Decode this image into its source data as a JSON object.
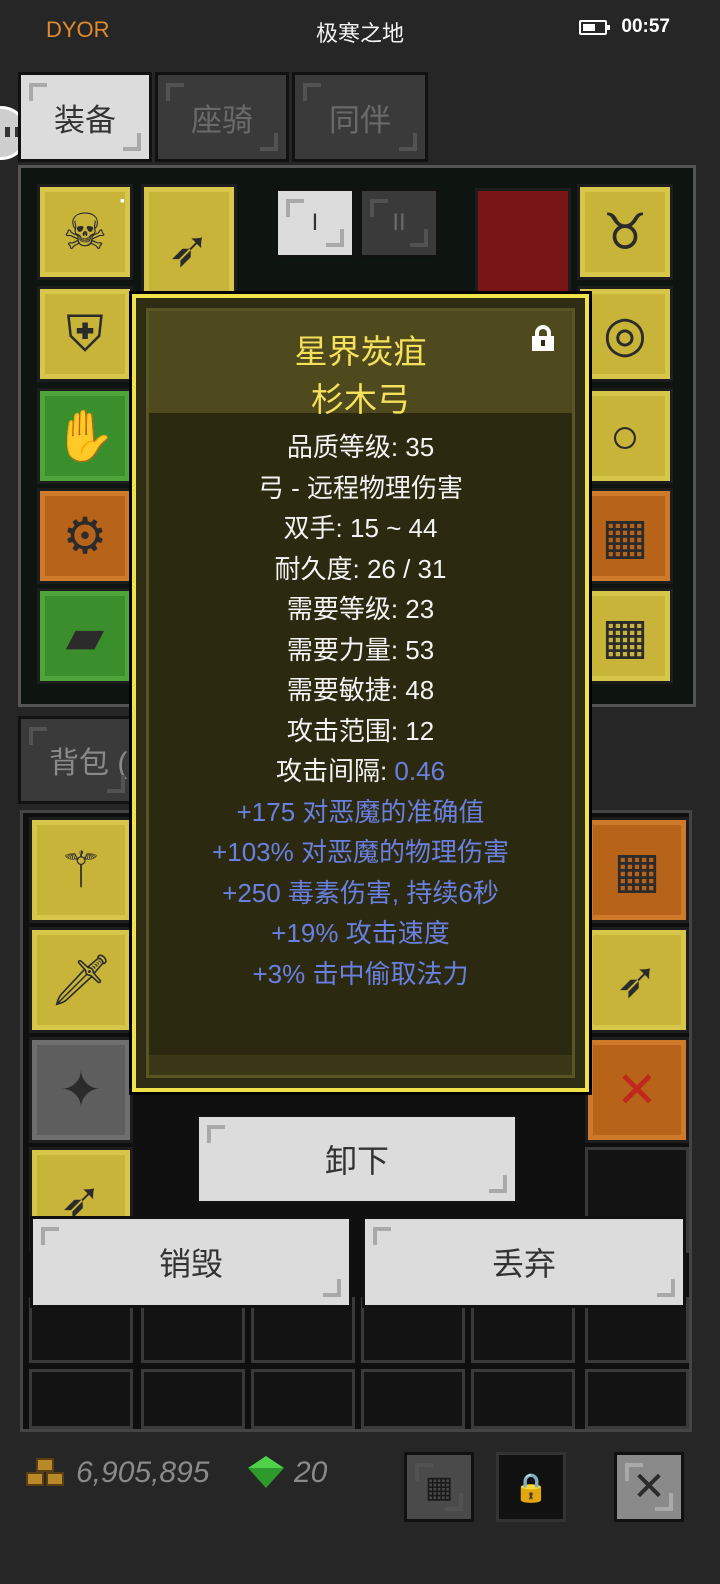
{
  "status_bar": {
    "app_label": "DYOR",
    "title": "极寒之地",
    "time": "00:57"
  },
  "tabs": [
    {
      "label": "装备",
      "active": true
    },
    {
      "label": "座骑",
      "active": false
    },
    {
      "label": "同伴",
      "active": false
    }
  ],
  "weapon_set_tabs": [
    "I",
    "II"
  ],
  "bag": {
    "tab_label": "背包 ("
  },
  "tooltip": {
    "name_line1": "星界炭疽",
    "name_line2": "杉木弓",
    "stats": [
      {
        "label": "品质等级: ",
        "value": "35"
      },
      {
        "label": "弓 - 远程物理伤害",
        "value": ""
      },
      {
        "label": "双手: ",
        "value": "15 ~ 44"
      },
      {
        "label": "耐久度: ",
        "value": "26 / 31"
      },
      {
        "label": "需要等级: ",
        "value": "23"
      },
      {
        "label": "需要力量: ",
        "value": "53"
      },
      {
        "label": "需要敏捷: ",
        "value": "48"
      },
      {
        "label": "攻击范围: ",
        "value": "12"
      },
      {
        "label": "攻击间隔: ",
        "value": "0.46"
      }
    ],
    "bonuses": [
      "+175 对恶魔的准确值",
      "+103% 对恶魔的物理伤害",
      "+250 毒素伤害, 持续6秒",
      "+19% 攻击速度",
      "+3% 击中偷取法力"
    ]
  },
  "actions": {
    "unequip": "卸下",
    "destroy": "销毁",
    "discard": "丢弃"
  },
  "currency": {
    "gold": "6,905,895",
    "gems": "20"
  },
  "colors": {
    "accent_orange": "#e08a2e",
    "tooltip_border": "#f0e34a",
    "item_name": "#f4e05a",
    "magic_blue": "#6a80e0"
  }
}
